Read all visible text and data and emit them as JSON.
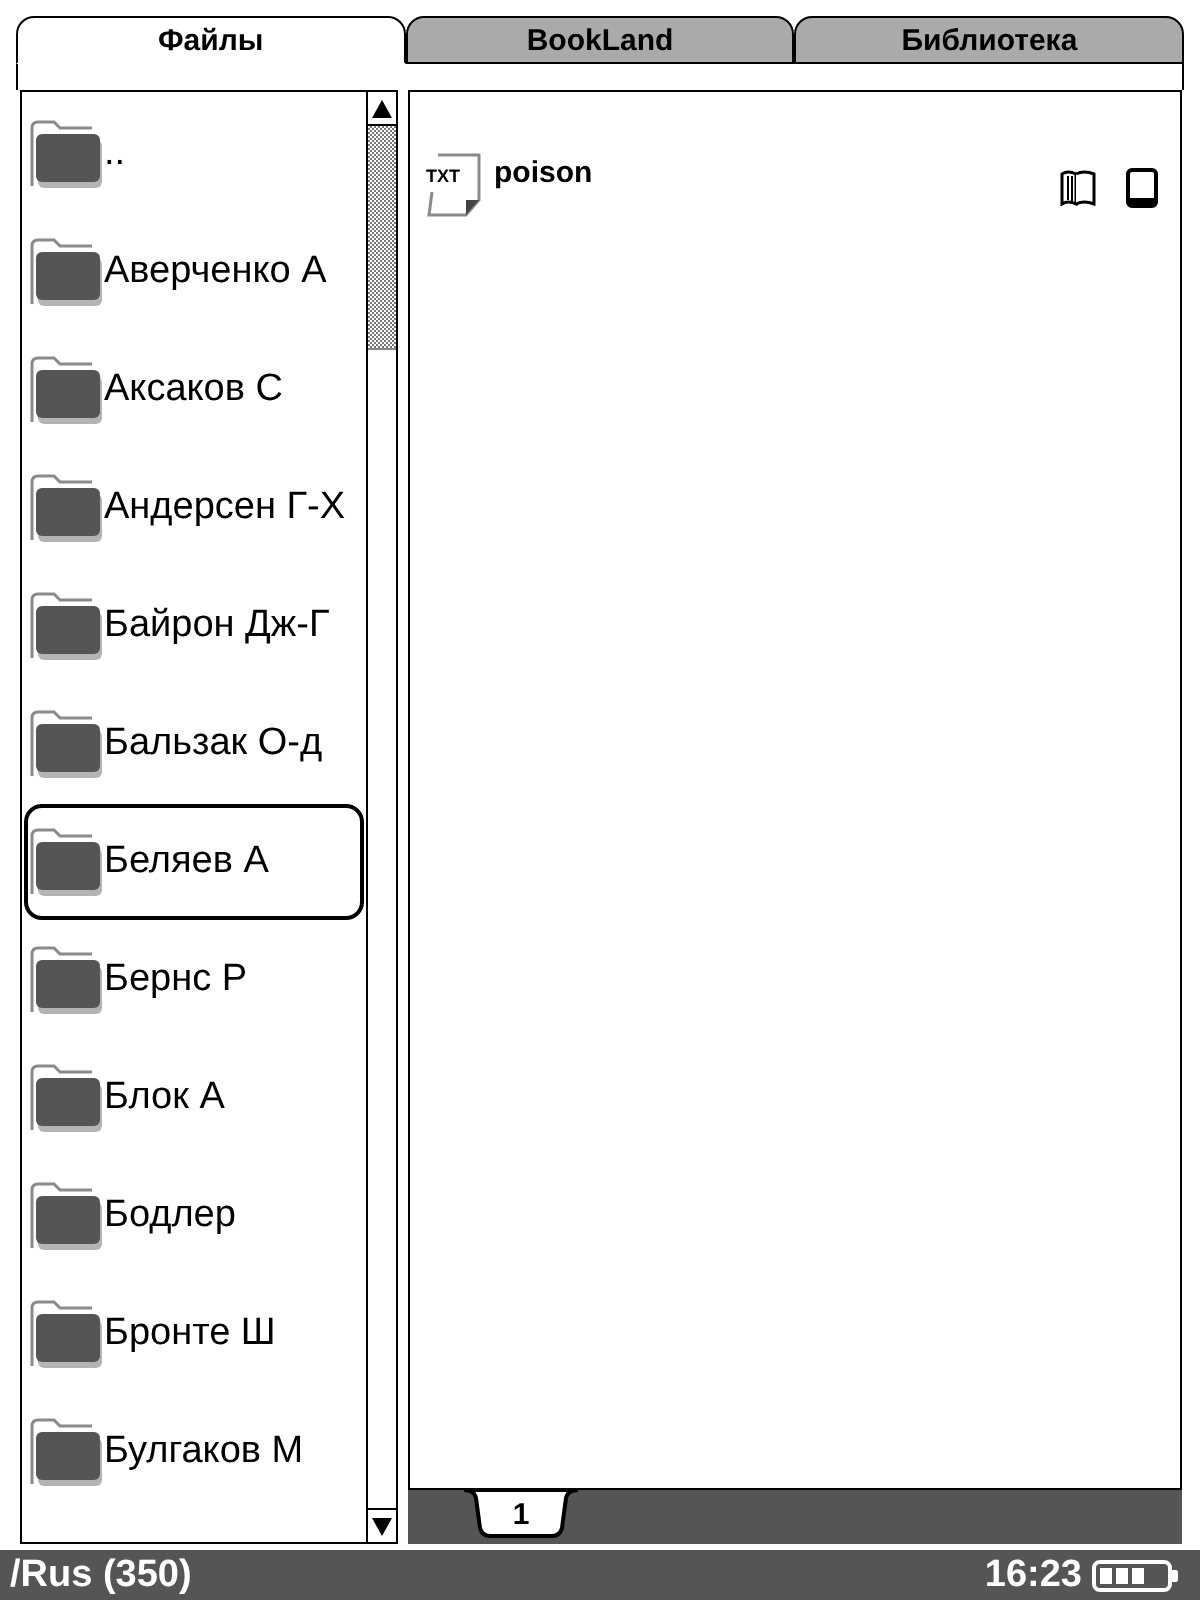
{
  "tabs": [
    {
      "label": "Файлы",
      "selected": true
    },
    {
      "label": "BookLand",
      "selected": false
    },
    {
      "label": "Библиотека",
      "selected": false
    }
  ],
  "folders": [
    {
      "name": "..",
      "selected": false
    },
    {
      "name": "Аверченко А",
      "selected": false
    },
    {
      "name": "Аксаков С",
      "selected": false
    },
    {
      "name": "Андерсен Г-Х",
      "selected": false
    },
    {
      "name": "Байрон Дж-Г",
      "selected": false
    },
    {
      "name": "Бальзак О-д",
      "selected": false
    },
    {
      "name": "Беляев А",
      "selected": true
    },
    {
      "name": "Бернс Р",
      "selected": false
    },
    {
      "name": "Блок А",
      "selected": false
    },
    {
      "name": "Бодлер",
      "selected": false
    },
    {
      "name": "Бронте Ш",
      "selected": false
    },
    {
      "name": "Булгаков М",
      "selected": false
    }
  ],
  "files": [
    {
      "type_label": "TXT",
      "name": "poison"
    }
  ],
  "pages": [
    {
      "label": "1",
      "selected": true
    }
  ],
  "status_bar": {
    "path": "/Rus (350)",
    "time": "16:23"
  }
}
